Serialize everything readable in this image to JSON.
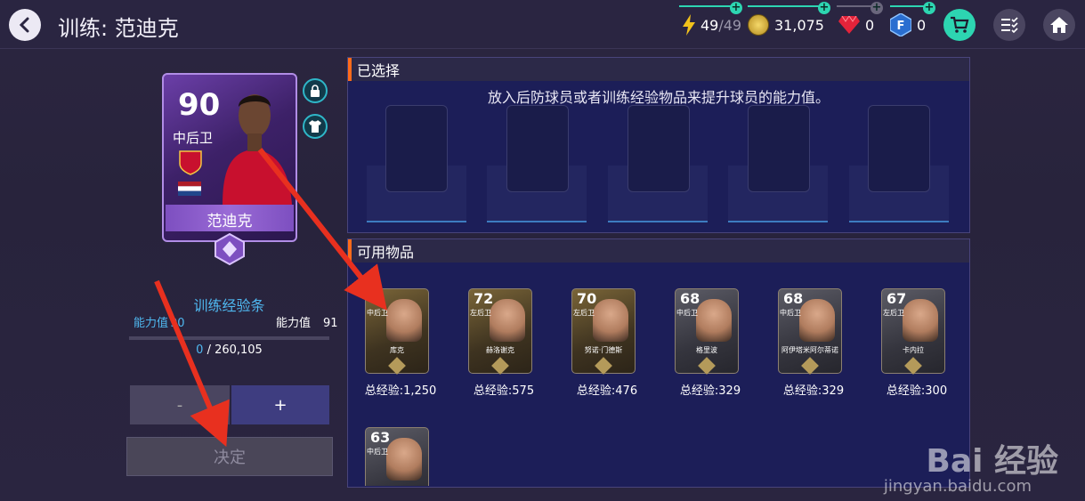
{
  "header": {
    "title": "训练: 范迪克",
    "energy": "49",
    "energy_max": "/49",
    "coins": "31,075",
    "gems": "0",
    "fifa_points": "0"
  },
  "player_card": {
    "rating": "90",
    "position": "中后卫",
    "name": "范迪克"
  },
  "training": {
    "xp_title": "训练经验条",
    "ability_label_left": "能力值",
    "ability_value_left": "90",
    "ability_label_right": "能力值",
    "ability_value_right": "91",
    "xp_current": "0",
    "xp_total": "/ 260,105",
    "xp_progress": 0,
    "minus_label": "-",
    "plus_label": "+",
    "confirm_label": "决定"
  },
  "selected_panel": {
    "title": "已选择",
    "hint": "放入后防球员或者训练经验物品来提升球员的能力值。"
  },
  "available_panel": {
    "title": "可用物品",
    "items": [
      {
        "rating": "",
        "position": "中后卫",
        "name": "库克",
        "exp": "总经验:1,250",
        "tier": "gold"
      },
      {
        "rating": "72",
        "position": "左后卫",
        "name": "赫洛谢克",
        "exp": "总经验:575",
        "tier": "gold"
      },
      {
        "rating": "70",
        "position": "左后卫",
        "name": "努诺·门德斯",
        "exp": "总经验:476",
        "tier": "gold"
      },
      {
        "rating": "68",
        "position": "中后卫",
        "name": "格里波",
        "exp": "总经验:329",
        "tier": "silver"
      },
      {
        "rating": "68",
        "position": "中后卫",
        "name": "阿伊塔米阿尔蒂诺",
        "exp": "总经验:329",
        "tier": "silver"
      },
      {
        "rating": "67",
        "position": "左后卫",
        "name": "卡内拉",
        "exp": "总经验:300",
        "tier": "silver"
      },
      {
        "rating": "63",
        "position": "中后卫",
        "name": "",
        "exp": "",
        "tier": "silver"
      }
    ]
  },
  "watermark": {
    "brand": "Bai 经验",
    "url": "jingyan.baidu.com"
  },
  "colors": {
    "accent": "#2dd5b1",
    "panel_bg": "#1c1e58",
    "header_accent": "#ff6b1a",
    "arrow": "#e8301f"
  }
}
